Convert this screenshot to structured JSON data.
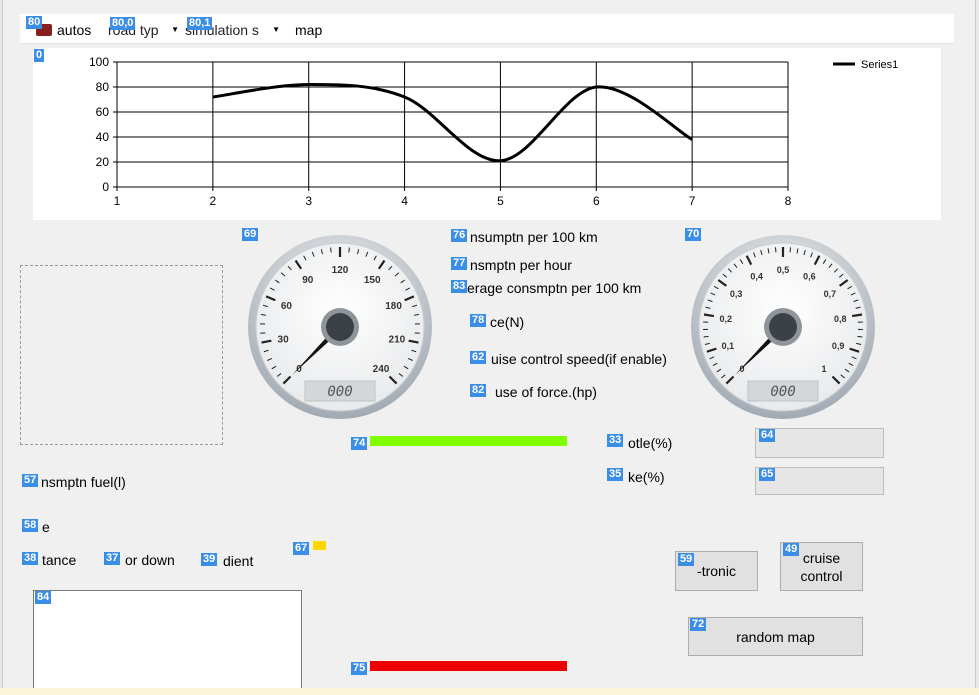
{
  "toolbar": {
    "tag_autos": "80",
    "autos_label": "autos",
    "tag_road": "80,0",
    "road_value": "road typ",
    "tag_sim": "80,1",
    "sim_value": "simulation s",
    "map_label": "map"
  },
  "chart_tag": "0",
  "chart_data": {
    "type": "line",
    "x": [
      2,
      3,
      4,
      5,
      6,
      7
    ],
    "series": [
      {
        "name": "Series1",
        "values": [
          72,
          82,
          72,
          21,
          80,
          38
        ]
      }
    ],
    "xlim": [
      1,
      8
    ],
    "ylim": [
      0,
      100
    ],
    "x_ticks": [
      "1",
      "2",
      "3",
      "4",
      "5",
      "6",
      "7",
      "8"
    ],
    "y_ticks": [
      "0",
      "20",
      "40",
      "60",
      "80",
      "100"
    ],
    "grid": true,
    "smooth": true,
    "legend": "top-right",
    "color": "#000000"
  },
  "gauge_speed": {
    "tag": "69",
    "tick_labels": [
      "0",
      "30",
      "60",
      "90",
      "120",
      "150",
      "180",
      "210",
      "240"
    ],
    "display": "000",
    "needle_value": 0
  },
  "gauge_throttle": {
    "tag": "70",
    "tick_labels": [
      "0",
      "0,1",
      "0,2",
      "0,3",
      "0,4",
      "0,5",
      "0,6",
      "0,7",
      "0,8",
      "0,9",
      "1"
    ],
    "display": "000",
    "needle_value": 0
  },
  "labels": {
    "consumption_100km": {
      "tag": "76",
      "text": "nsumptn per 100 km"
    },
    "consumption_hour": {
      "tag": "77",
      "text": "nsmptn per hour"
    },
    "avg_consumption": {
      "tag": "83",
      "text": "erage consmptn per 100 km"
    },
    "force": {
      "tag": "78",
      "text": "ce(N)"
    },
    "cruise_speed": {
      "tag": "62",
      "text": "uise control speed(if enable)"
    },
    "use_of_force": {
      "tag": "82",
      "text": "use of force.(hp)"
    },
    "throttle": {
      "tag": "33",
      "text": "otle(%)"
    },
    "brake": {
      "tag": "35",
      "text": "ke(%)"
    },
    "fuel": {
      "tag": "57",
      "text": "nsmptn fuel(l)"
    },
    "label_58": {
      "tag": "58",
      "text": "e"
    },
    "distance": {
      "tag": "38",
      "text": "tance"
    },
    "up_down": {
      "tag": "37",
      "text": "or down"
    },
    "gradient": {
      "tag": "39",
      "text": "dient"
    }
  },
  "bars": {
    "green": {
      "tag": "74",
      "color": "#80ff00"
    },
    "red": {
      "tag": "75",
      "color": "#ee0000"
    },
    "yellow": {
      "tag": "67",
      "color": "#ffd700"
    }
  },
  "displays": {
    "throttle_value": {
      "tag": "64"
    },
    "brake_value": {
      "tag": "65"
    }
  },
  "buttons": {
    "tronic": {
      "tag": "59",
      "label": "-tronic"
    },
    "cruise": {
      "tag": "49",
      "label": "cruise control"
    },
    "random_map": {
      "tag": "72",
      "label": "random map"
    }
  },
  "textarea_tag": "84"
}
